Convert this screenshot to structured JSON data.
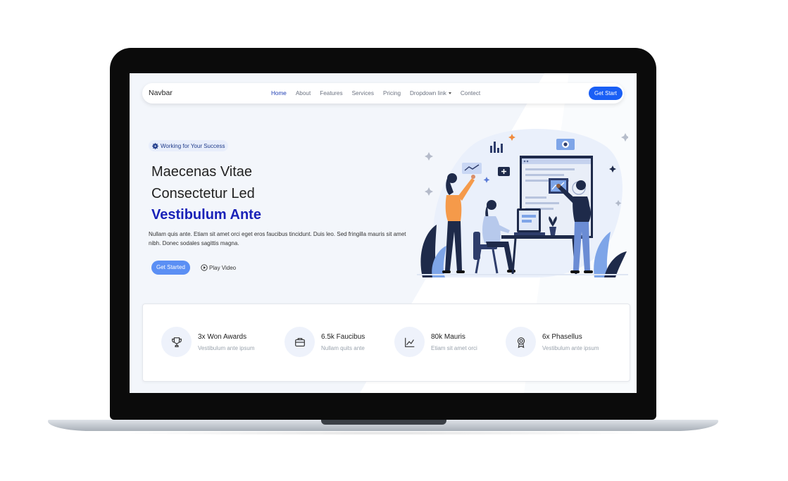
{
  "navbar": {
    "brand": "Navbar",
    "links": [
      {
        "label": "Home",
        "active": true
      },
      {
        "label": "About"
      },
      {
        "label": "Features"
      },
      {
        "label": "Services"
      },
      {
        "label": "Pricing"
      },
      {
        "label": "Dropdown link",
        "dropdown": true
      },
      {
        "label": "Contect"
      }
    ],
    "cta": "Get Start"
  },
  "hero": {
    "badge": "Working for Your Success",
    "badge_icon": "gear-icon",
    "title_line1": "Maecenas Vitae",
    "title_line2": "Consectetur Led",
    "title_line3": "Vestibulum Ante",
    "description": "Nullam quis ante. Etiam sit amet orci eget eros faucibus tincidunt. Duis leo. Sed fringilla mauris sit amet nibh. Donec sodales sagittis magna.",
    "primary_button": "Get Started",
    "secondary_button": "Play Video",
    "secondary_icon": "play-circle-icon"
  },
  "stats": [
    {
      "icon": "trophy-icon",
      "title": "3x Won Awards",
      "subtitle": "Vestibulum ante ipsum"
    },
    {
      "icon": "briefcase-icon",
      "title": "6.5k Faucibus",
      "subtitle": "Nullam quits ante"
    },
    {
      "icon": "chart-line-icon",
      "title": "80k Mauris",
      "subtitle": "Etiam sit amet orci"
    },
    {
      "icon": "award-icon",
      "title": "6x Phasellus",
      "subtitle": "Vestibulum ante ipsum"
    }
  ],
  "colors": {
    "accent": "#1a5ff5",
    "heading_accent": "#1a22b8",
    "hero_bg": "#f3f6fb",
    "icon_bg": "#eef2fb",
    "laptop_frame": "#0b0b0b"
  }
}
